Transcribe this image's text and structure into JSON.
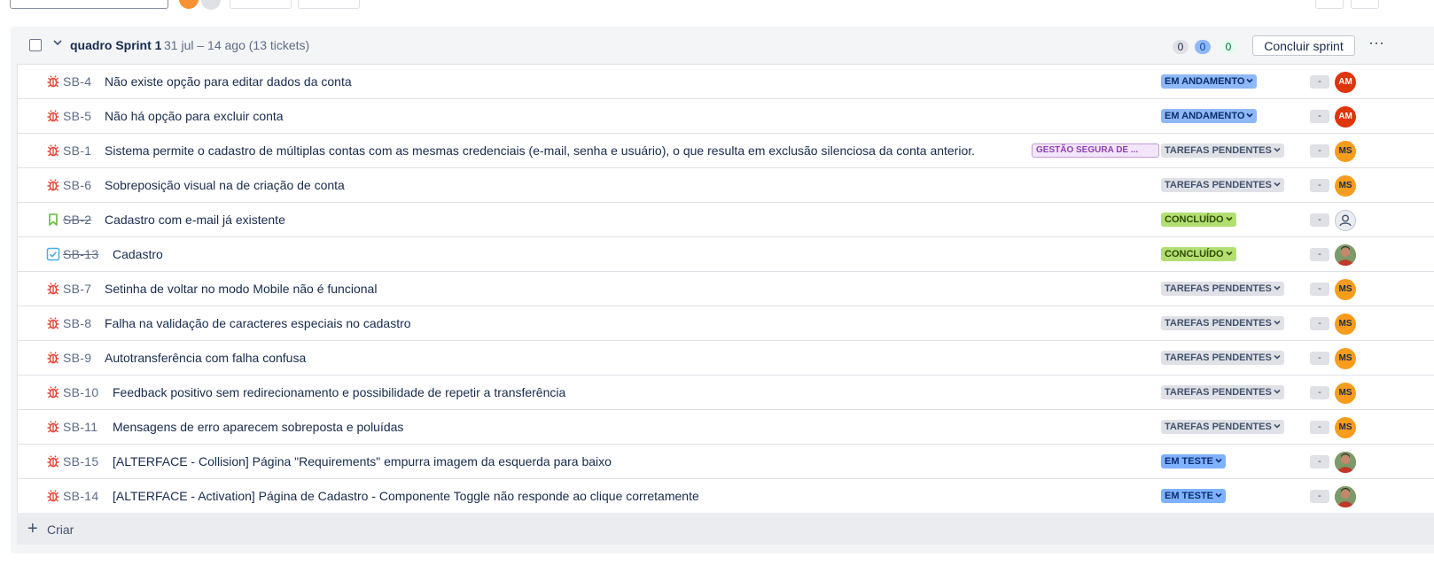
{
  "sprint": {
    "name": "quadro Sprint 1",
    "dates": "31 jul – 14 ago (13 tickets)",
    "counts": {
      "todo": "0",
      "in_progress": "0",
      "done": "0"
    },
    "complete_label": "Concluir sprint",
    "more_label": "···"
  },
  "issues": [
    {
      "type": "bug",
      "key": "SB-4",
      "summary": "Não existe opção para editar dados da conta",
      "status": "EM ANDAMENTO",
      "status_kind": "prog",
      "estimate": "-",
      "assignee": "AM",
      "assignee_kind": "am",
      "done": false,
      "epic": ""
    },
    {
      "type": "bug",
      "key": "SB-5",
      "summary": "Não há opção para excluir conta",
      "status": "EM ANDAMENTO",
      "status_kind": "prog",
      "estimate": "-",
      "assignee": "AM",
      "assignee_kind": "am",
      "done": false,
      "epic": ""
    },
    {
      "type": "bug",
      "key": "SB-1",
      "summary": "Sistema permite o cadastro de múltiplas contas com as mesmas credenciais (e-mail, senha e usuário), o que resulta em exclusão silenciosa da conta anterior.",
      "status": "TAREFAS PENDENTES",
      "status_kind": "todo",
      "estimate": "-",
      "assignee": "MS",
      "assignee_kind": "ms",
      "done": false,
      "epic": "GESTÃO SEGURA DE ..."
    },
    {
      "type": "bug",
      "key": "SB-6",
      "summary": "Sobreposição visual na de criação de conta",
      "status": "TAREFAS PENDENTES",
      "status_kind": "todo",
      "estimate": "-",
      "assignee": "MS",
      "assignee_kind": "ms",
      "done": false,
      "epic": ""
    },
    {
      "type": "story",
      "key": "SB-2",
      "summary": "Cadastro com e-mail já existente",
      "status": "CONCLUÍDO",
      "status_kind": "done",
      "estimate": "-",
      "assignee": "",
      "assignee_kind": "empty",
      "done": true,
      "epic": ""
    },
    {
      "type": "task",
      "key": "SB-13",
      "summary": "Cadastro",
      "status": "CONCLUÍDO",
      "status_kind": "done",
      "estimate": "-",
      "assignee": "",
      "assignee_kind": "photo",
      "done": true,
      "epic": ""
    },
    {
      "type": "bug",
      "key": "SB-7",
      "summary": "Setinha de voltar no modo Mobile não é funcional",
      "status": "TAREFAS PENDENTES",
      "status_kind": "todo",
      "estimate": "-",
      "assignee": "MS",
      "assignee_kind": "ms",
      "done": false,
      "epic": ""
    },
    {
      "type": "bug",
      "key": "SB-8",
      "summary": "Falha na validação de caracteres especiais no cadastro",
      "status": "TAREFAS PENDENTES",
      "status_kind": "todo",
      "estimate": "-",
      "assignee": "MS",
      "assignee_kind": "ms",
      "done": false,
      "epic": ""
    },
    {
      "type": "bug",
      "key": "SB-9",
      "summary": "Autotransferência com falha confusa",
      "status": "TAREFAS PENDENTES",
      "status_kind": "todo",
      "estimate": "-",
      "assignee": "MS",
      "assignee_kind": "ms",
      "done": false,
      "epic": ""
    },
    {
      "type": "bug",
      "key": "SB-10",
      "summary": "Feedback positivo sem redirecionamento e possibilidade de repetir a transferência",
      "status": "TAREFAS PENDENTES",
      "status_kind": "todo",
      "estimate": "-",
      "assignee": "MS",
      "assignee_kind": "ms",
      "done": false,
      "epic": ""
    },
    {
      "type": "bug",
      "key": "SB-11",
      "summary": "Mensagens de erro aparecem sobreposta e poluídas",
      "status": "TAREFAS PENDENTES",
      "status_kind": "todo",
      "estimate": "-",
      "assignee": "MS",
      "assignee_kind": "ms",
      "done": false,
      "epic": ""
    },
    {
      "type": "bug",
      "key": "SB-15",
      "summary": "[ALTERFACE - Collision] Página \"Requirements\" empurra imagem da esquerda para baixo",
      "status": "EM TESTE",
      "status_kind": "test",
      "estimate": "-",
      "assignee": "",
      "assignee_kind": "photo",
      "done": false,
      "epic": ""
    },
    {
      "type": "bug",
      "key": "SB-14",
      "summary": "[ALTERFACE - Activation] Página de Cadastro - Componente Toggle não responde ao clique corretamente",
      "status": "EM TESTE",
      "status_kind": "test",
      "estimate": "-",
      "assignee": "",
      "assignee_kind": "photo",
      "done": false,
      "epic": ""
    }
  ],
  "create_label": "Criar",
  "colors": {
    "bug": "#e5493a",
    "story": "#63ba3c",
    "task": "#4bade8",
    "brand": "#0c66e4"
  }
}
